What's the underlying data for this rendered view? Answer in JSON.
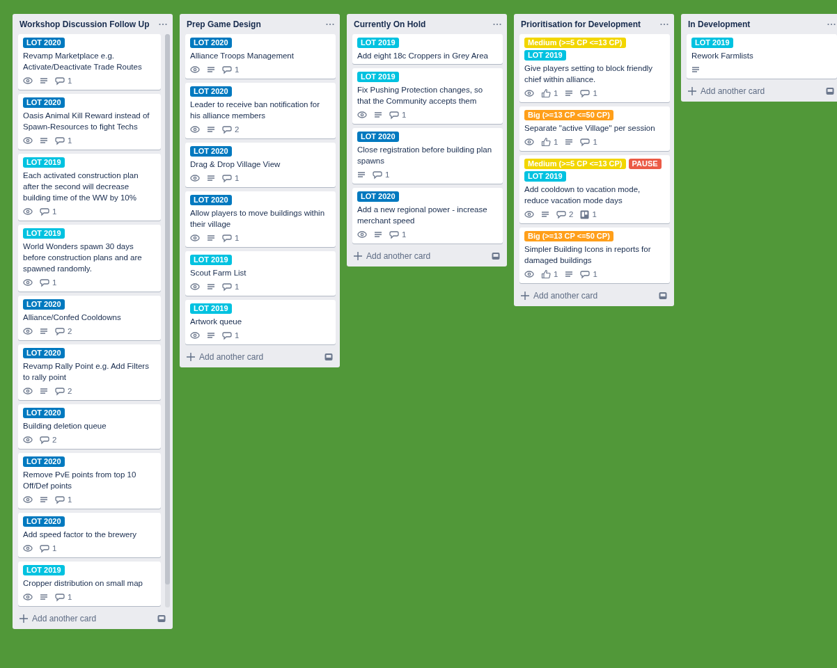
{
  "lists": [
    {
      "title": "Workshop Discussion Follow Up",
      "scrollbar": true,
      "add_card": "Add another card",
      "cards": [
        {
          "labels": [
            {
              "text": "LOT 2020",
              "color": "#0079bf"
            }
          ],
          "title": "Revamp Marketplace e.g. Activate/Deactivate Trade Routes",
          "badges": [
            {
              "kind": "watch"
            },
            {
              "kind": "description"
            },
            {
              "kind": "comments",
              "count": "1"
            }
          ]
        },
        {
          "labels": [
            {
              "text": "LOT 2020",
              "color": "#0079bf"
            }
          ],
          "title": "Oasis Animal Kill Reward instead of Spawn-Resources to fight Techs",
          "badges": [
            {
              "kind": "watch"
            },
            {
              "kind": "description"
            },
            {
              "kind": "comments",
              "count": "1"
            }
          ]
        },
        {
          "labels": [
            {
              "text": "LOT 2019",
              "color": "#00c2e0"
            }
          ],
          "title": "Each activated construction plan after the second will decrease building time of the WW by 10%",
          "badges": [
            {
              "kind": "watch"
            },
            {
              "kind": "comments",
              "count": "1"
            }
          ]
        },
        {
          "labels": [
            {
              "text": "LOT 2019",
              "color": "#00c2e0"
            }
          ],
          "title": "World Wonders spawn 30 days before construction plans and are spawned randomly.",
          "badges": [
            {
              "kind": "watch"
            },
            {
              "kind": "comments",
              "count": "1"
            }
          ]
        },
        {
          "labels": [
            {
              "text": "LOT 2020",
              "color": "#0079bf"
            }
          ],
          "title": "Alliance/Confed Cooldowns",
          "badges": [
            {
              "kind": "watch"
            },
            {
              "kind": "description"
            },
            {
              "kind": "comments",
              "count": "2"
            }
          ]
        },
        {
          "labels": [
            {
              "text": "LOT 2020",
              "color": "#0079bf"
            }
          ],
          "title": "Revamp Rally Point e.g. Add Filters to rally point",
          "badges": [
            {
              "kind": "watch"
            },
            {
              "kind": "description"
            },
            {
              "kind": "comments",
              "count": "2"
            }
          ]
        },
        {
          "labels": [
            {
              "text": "LOT 2020",
              "color": "#0079bf"
            }
          ],
          "title": "Building deletion queue",
          "badges": [
            {
              "kind": "watch"
            },
            {
              "kind": "comments",
              "count": "2"
            }
          ]
        },
        {
          "labels": [
            {
              "text": "LOT 2020",
              "color": "#0079bf"
            }
          ],
          "title": "Remove PvE points from top 10 Off/Def points",
          "badges": [
            {
              "kind": "watch"
            },
            {
              "kind": "description"
            },
            {
              "kind": "comments",
              "count": "1"
            }
          ]
        },
        {
          "labels": [
            {
              "text": "LOT 2020",
              "color": "#0079bf"
            }
          ],
          "title": "Add speed factor to the brewery",
          "badges": [
            {
              "kind": "watch"
            },
            {
              "kind": "comments",
              "count": "1"
            }
          ]
        },
        {
          "labels": [
            {
              "text": "LOT 2019",
              "color": "#00c2e0"
            }
          ],
          "title": "Cropper distribution on small map",
          "badges": [
            {
              "kind": "watch"
            },
            {
              "kind": "description"
            },
            {
              "kind": "comments",
              "count": "1"
            }
          ]
        }
      ]
    },
    {
      "title": "Prep Game Design",
      "scrollbar": false,
      "add_card": "Add another card",
      "cards": [
        {
          "labels": [
            {
              "text": "LOT 2020",
              "color": "#0079bf"
            }
          ],
          "title": "Alliance Troops Management",
          "badges": [
            {
              "kind": "watch"
            },
            {
              "kind": "description"
            },
            {
              "kind": "comments",
              "count": "1"
            }
          ]
        },
        {
          "labels": [
            {
              "text": "LOT 2020",
              "color": "#0079bf"
            }
          ],
          "title": "Leader to receive ban notification for his alliance members",
          "badges": [
            {
              "kind": "watch"
            },
            {
              "kind": "description"
            },
            {
              "kind": "comments",
              "count": "2"
            }
          ]
        },
        {
          "labels": [
            {
              "text": "LOT 2020",
              "color": "#0079bf"
            }
          ],
          "title": "Drag & Drop Village View",
          "badges": [
            {
              "kind": "watch"
            },
            {
              "kind": "description"
            },
            {
              "kind": "comments",
              "count": "1"
            }
          ]
        },
        {
          "labels": [
            {
              "text": "LOT 2020",
              "color": "#0079bf"
            }
          ],
          "title": "Allow players to move buildings within their village",
          "badges": [
            {
              "kind": "watch"
            },
            {
              "kind": "description"
            },
            {
              "kind": "comments",
              "count": "1"
            }
          ]
        },
        {
          "labels": [
            {
              "text": "LOT 2019",
              "color": "#00c2e0"
            }
          ],
          "title": "Scout Farm List",
          "badges": [
            {
              "kind": "watch"
            },
            {
              "kind": "description"
            },
            {
              "kind": "comments",
              "count": "1"
            }
          ]
        },
        {
          "labels": [
            {
              "text": "LOT 2019",
              "color": "#00c2e0"
            }
          ],
          "title": "Artwork queue",
          "badges": [
            {
              "kind": "watch"
            },
            {
              "kind": "description"
            },
            {
              "kind": "comments",
              "count": "1"
            }
          ]
        }
      ]
    },
    {
      "title": "Currently On Hold",
      "scrollbar": false,
      "add_card": "Add another card",
      "cards": [
        {
          "labels": [
            {
              "text": "LOT 2019",
              "color": "#00c2e0"
            }
          ],
          "title": "Add eight 18c Croppers in Grey Area"
        },
        {
          "labels": [
            {
              "text": "LOT 2019",
              "color": "#00c2e0"
            }
          ],
          "title": "Fix Pushing Protection changes, so that the Community accepts them",
          "badges": [
            {
              "kind": "watch"
            },
            {
              "kind": "description"
            },
            {
              "kind": "comments",
              "count": "1"
            }
          ]
        },
        {
          "labels": [
            {
              "text": "LOT 2020",
              "color": "#0079bf"
            }
          ],
          "title": "Close registration before building plan spawns",
          "badges": [
            {
              "kind": "description"
            },
            {
              "kind": "comments",
              "count": "1"
            }
          ]
        },
        {
          "labels": [
            {
              "text": "LOT 2020",
              "color": "#0079bf"
            }
          ],
          "title": "Add a new regional power - increase merchant speed",
          "badges": [
            {
              "kind": "watch"
            },
            {
              "kind": "description"
            },
            {
              "kind": "comments",
              "count": "1"
            }
          ]
        }
      ]
    },
    {
      "title": "Prioritisation for Development",
      "scrollbar": false,
      "add_card": "Add another card",
      "cards": [
        {
          "labels": [
            {
              "text": "Medium (>=5 CP <=13 CP)",
              "color": "#f2d600"
            },
            {
              "text": "LOT 2019",
              "color": "#00c2e0"
            }
          ],
          "title": "Give players setting to block friendly chief within alliance.",
          "badges": [
            {
              "kind": "watch"
            },
            {
              "kind": "votes",
              "count": "1"
            },
            {
              "kind": "description"
            },
            {
              "kind": "comments",
              "count": "1"
            }
          ]
        },
        {
          "labels": [
            {
              "text": "Big (>=13 CP <=50 CP)",
              "color": "#ff9f1a"
            }
          ],
          "title": "Separate \"active Village\" per session",
          "badges": [
            {
              "kind": "watch"
            },
            {
              "kind": "votes",
              "count": "1"
            },
            {
              "kind": "description"
            },
            {
              "kind": "comments",
              "count": "1"
            }
          ]
        },
        {
          "labels": [
            {
              "text": "Medium (>=5 CP <=13 CP)",
              "color": "#f2d600"
            },
            {
              "text": "PAUSE",
              "color": "#eb5a46"
            },
            {
              "text": "LOT 2019",
              "color": "#00c2e0"
            }
          ],
          "title": "Add cooldown to vacation mode, reduce vacation mode days",
          "badges": [
            {
              "kind": "watch"
            },
            {
              "kind": "description"
            },
            {
              "kind": "comments",
              "count": "2"
            },
            {
              "kind": "linked",
              "count": "1"
            }
          ]
        },
        {
          "labels": [
            {
              "text": "Big (>=13 CP <=50 CP)",
              "color": "#ff9f1a"
            }
          ],
          "title": "Simpler Building Icons in reports for damaged buildings",
          "badges": [
            {
              "kind": "watch"
            },
            {
              "kind": "votes",
              "count": "1"
            },
            {
              "kind": "description"
            },
            {
              "kind": "comments",
              "count": "1"
            }
          ]
        }
      ]
    },
    {
      "title": "In Development",
      "scrollbar": false,
      "add_card": "Add another card",
      "cards": [
        {
          "labels": [
            {
              "text": "LOT 2019",
              "color": "#00c2e0"
            }
          ],
          "title": "Rework Farmlists",
          "badges": [
            {
              "kind": "description"
            }
          ]
        }
      ]
    }
  ]
}
